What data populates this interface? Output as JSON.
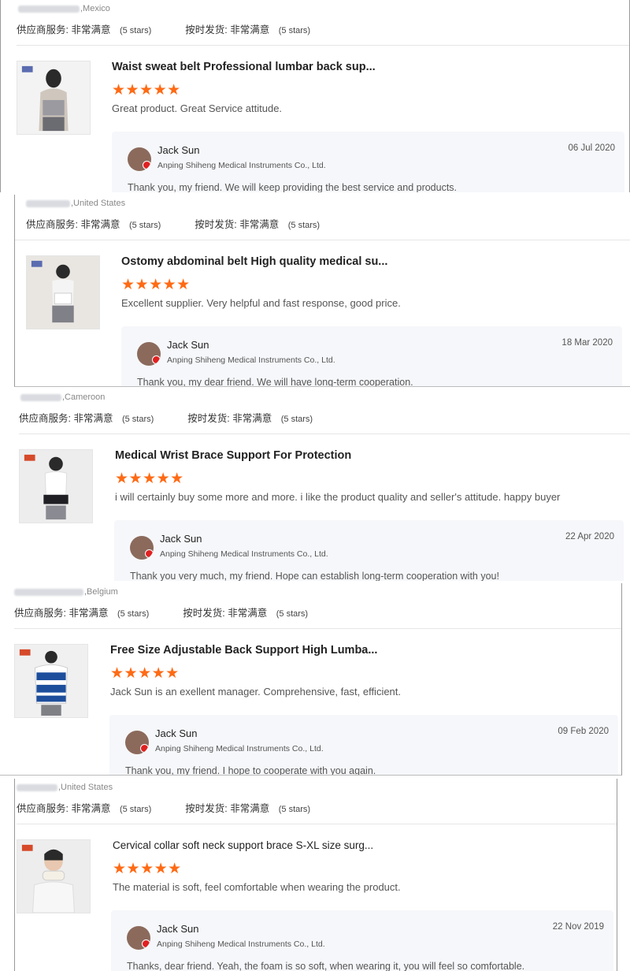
{
  "labels": {
    "supplier_service": "供应商服务:",
    "on_time_delivery": "按时发货:",
    "rating_value": "非常满意",
    "stars_count": "(5 stars)"
  },
  "colors": {
    "star": "#ff6a14",
    "reply_bg": "#f6f7fa"
  },
  "reviews": [
    {
      "country": ",Mexico",
      "product_title": "Waist sweat belt Professional lumbar back sup...",
      "stars": "★★★★★",
      "review_text": "Great product. Great Service attitude.",
      "reply": {
        "name": "Jack Sun",
        "company": "Anping Shiheng Medical Instruments Co., Ltd.",
        "date": "06 Jul 2020",
        "text": "Thank you, my friend. We will keep providing the best service and products."
      }
    },
    {
      "country": ",United States",
      "product_title": "Ostomy abdominal belt High quality medical su...",
      "stars": "★★★★★",
      "review_text": "Excellent supplier. Very helpful and fast response, good price.",
      "reply": {
        "name": "Jack Sun",
        "company": "Anping Shiheng Medical Instruments Co., Ltd.",
        "date": "18 Mar 2020",
        "text": "Thank you, my dear friend. We will have long-term cooperation."
      }
    },
    {
      "country": ",Cameroon",
      "product_title": "Medical Wrist Brace Support For Protection",
      "stars": "★★★★★",
      "review_text": "i will certainly buy some more and more. i like the product quality and seller's attitude. happy buyer",
      "reply": {
        "name": "Jack Sun",
        "company": "Anping Shiheng Medical Instruments Co., Ltd.",
        "date": "22 Apr 2020",
        "text": "Thank you very much, my friend. Hope can establish long-term cooperation with you!"
      }
    },
    {
      "country": ",Belgium",
      "product_title": "Free Size Adjustable Back Support High Lumba...",
      "stars": "★★★★★",
      "review_text": "Jack Sun is an exellent manager.  Comprehensive, fast, efficient.",
      "reply": {
        "name": "Jack Sun",
        "company": "Anping Shiheng Medical Instruments Co., Ltd.",
        "date": "09 Feb 2020",
        "text": "Thank you, my friend. I hope to cooperate with you again."
      }
    },
    {
      "country": ",United States",
      "product_title": "Cervical collar soft neck support brace S-XL size surg...",
      "stars": "★★★★★",
      "review_text": "The material is soft, feel comfortable when wearing the product.",
      "reply": {
        "name": "Jack Sun",
        "company": "Anping Shiheng Medical Instruments Co., Ltd.",
        "date": "22 Nov 2019",
        "text": "Thanks, dear friend. Yeah, the foam is so soft, when wearing it, you will feel so comfortable."
      }
    }
  ]
}
